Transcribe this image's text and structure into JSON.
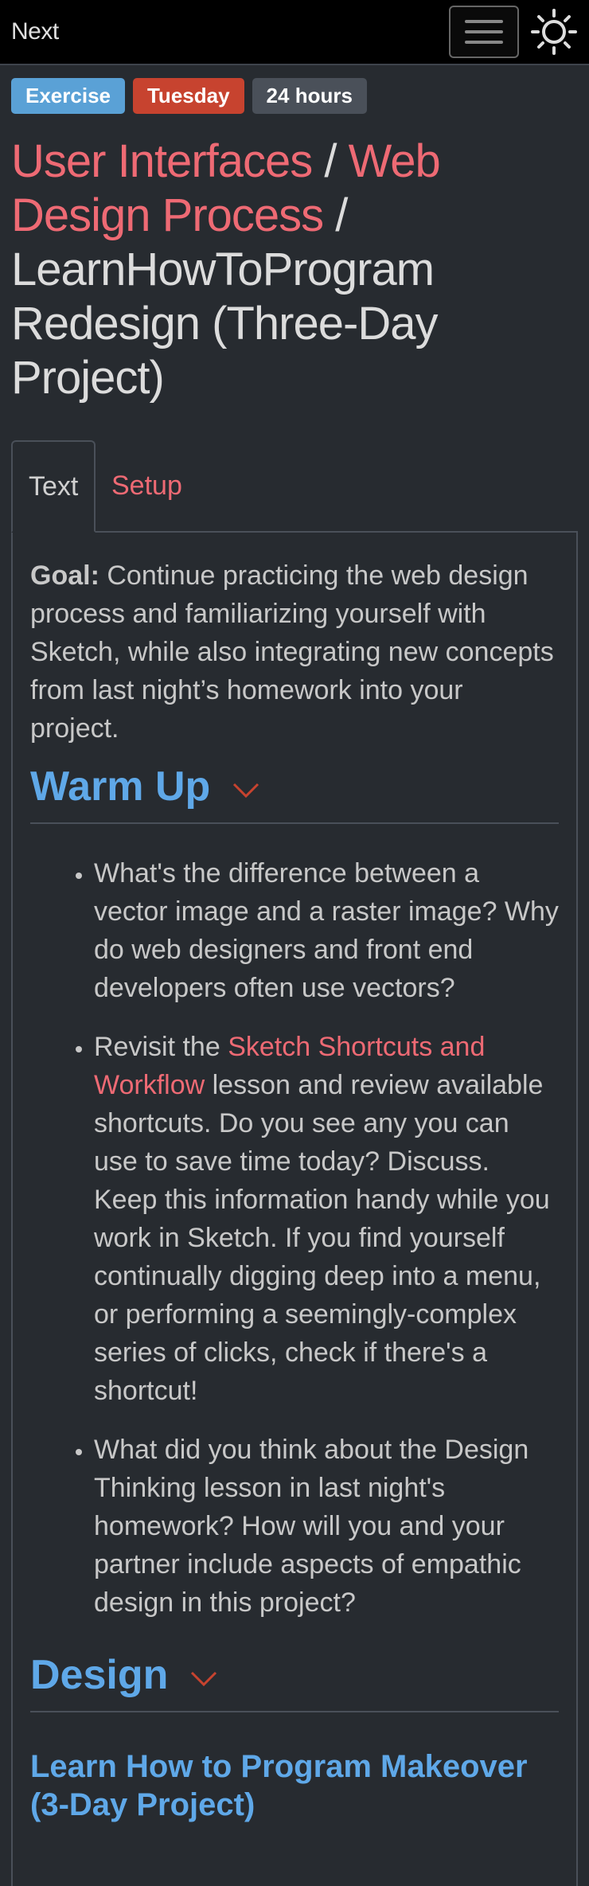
{
  "navbar": {
    "next_label": "Next",
    "menu_icon": "hamburger-menu-icon",
    "theme_icon": "sun-icon"
  },
  "badges": [
    {
      "label": "Exercise",
      "color": "#5aa1d6"
    },
    {
      "label": "Tuesday",
      "color": "#c7432f"
    },
    {
      "label": "24 hours",
      "color": "#4a5059"
    }
  ],
  "breadcrumb": {
    "course": "User Interfaces",
    "separator1": " / ",
    "section": "Web Design Process",
    "separator2": " / ",
    "lesson": "LearnHowToProgram Redesign (Three-Day Project)"
  },
  "tabs": {
    "text": "Text",
    "setup": "Setup"
  },
  "content": {
    "goal_label": "Goal:",
    "goal_text": " Continue practicing the web design process and familiarizing yourself with Sketch, while also integrating new concepts from last night’s homework into your project.",
    "warmup_heading": "Warm Up",
    "warmup_items": {
      "q1": "What's the difference between a vector image and a raster image? Why do web designers and front end developers often use vectors?",
      "q2_before": "Revisit the ",
      "q2_link": "Sketch Shortcuts and Workflow",
      "q2_after": " lesson and review available shortcuts. Do you see any you can use to save time today? Discuss. Keep this information handy while you work in Sketch. If you find yourself continually digging deep into a menu, or performing a seemingly-complex series of clicks, check if there's a shortcut!",
      "q3": "What did you think about the Design Thinking lesson in last night's homework? How will you and your partner include aspects of empathic design in this project?"
    },
    "design_heading": "Design",
    "design_subheading": "Learn How to Program Makeover (3-Day Project)"
  },
  "colors": {
    "accent_link": "#ee6a74",
    "heading_blue": "#5fa8e8",
    "background": "#272b30"
  }
}
